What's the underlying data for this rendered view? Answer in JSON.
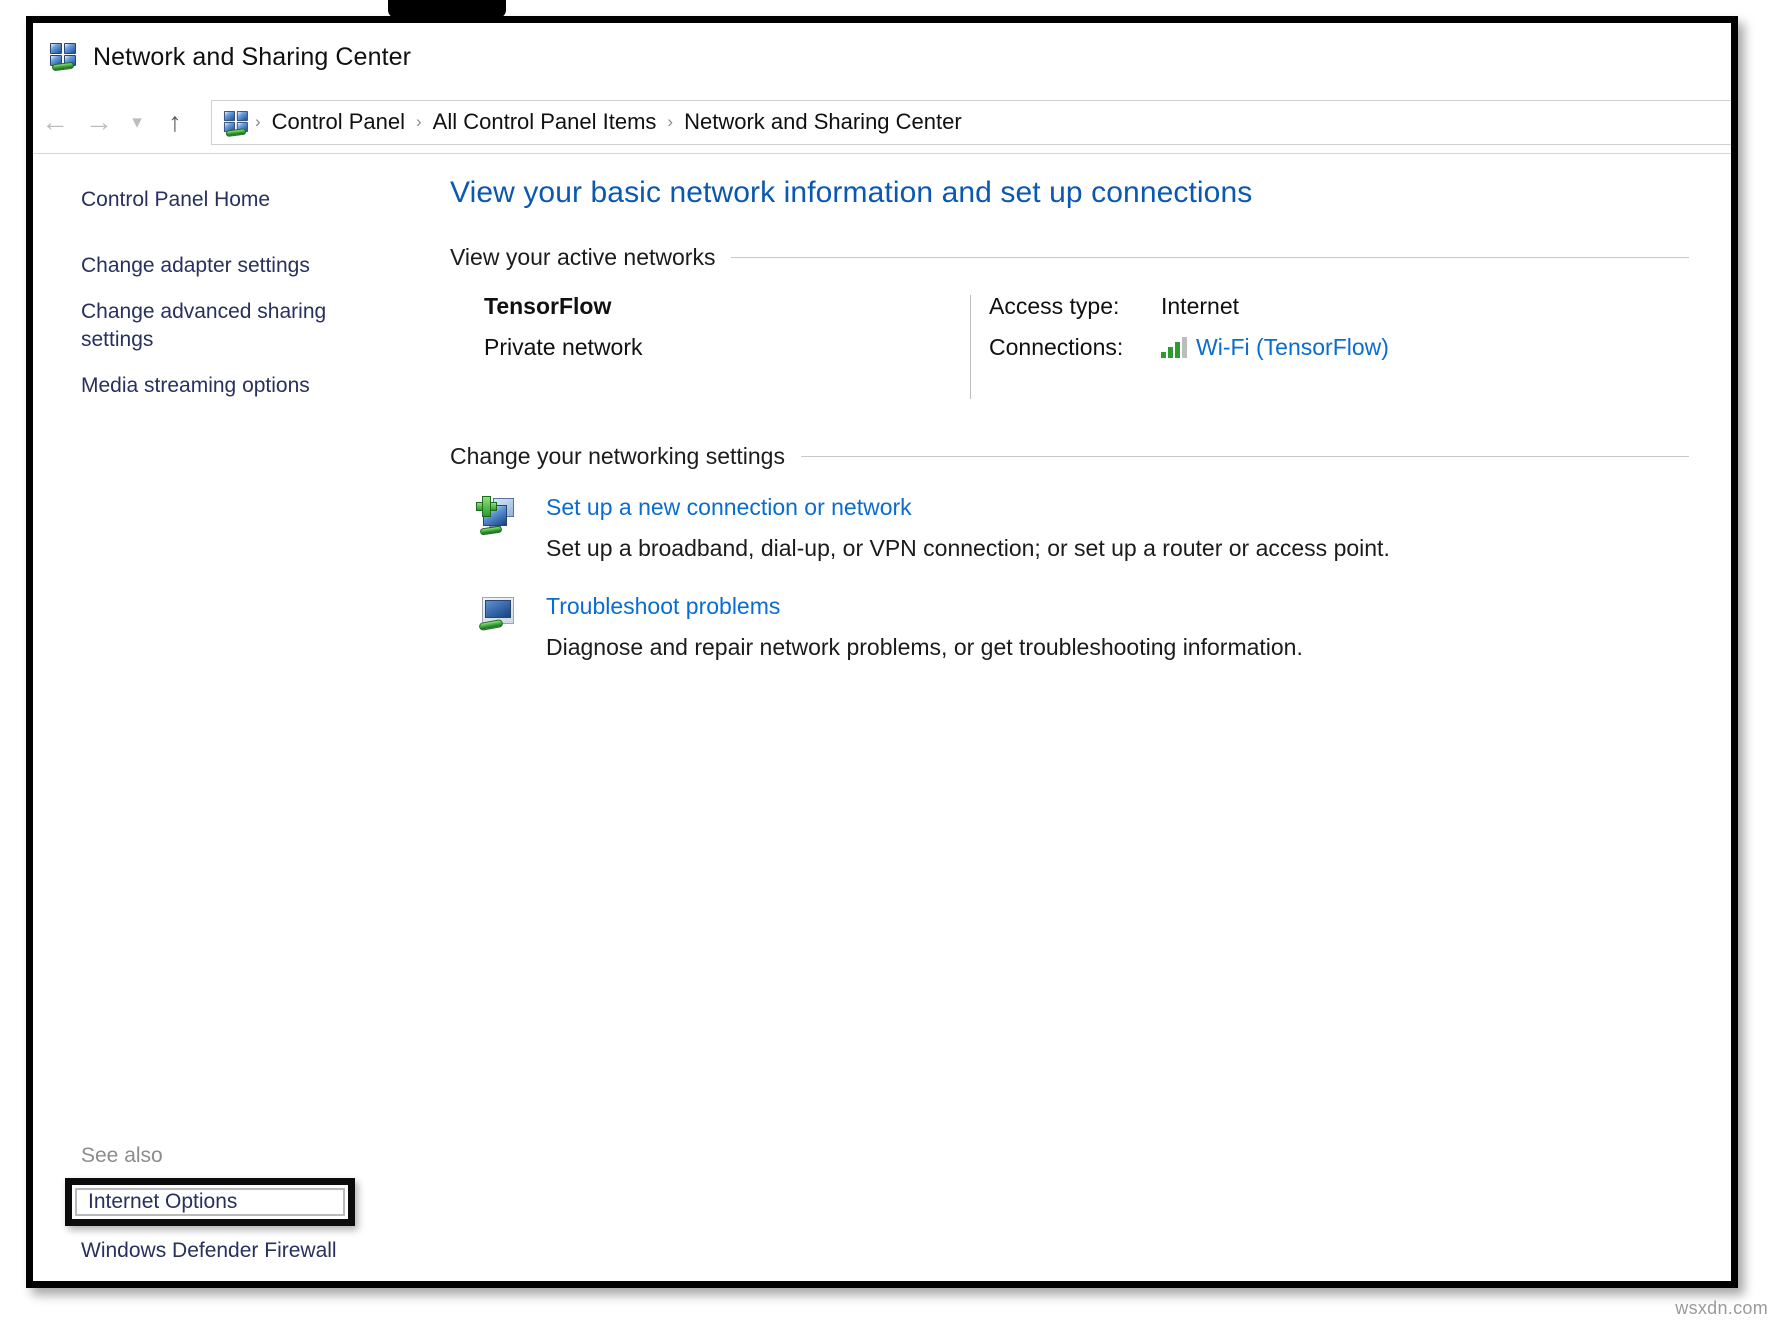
{
  "window": {
    "title": "Network and Sharing Center",
    "title_icon": "network-sharing-icon"
  },
  "navbar": {
    "back_icon": "arrow-left-icon",
    "forward_icon": "arrow-right-icon",
    "recent_icon": "chevron-down-icon",
    "up_icon": "arrow-up-icon",
    "address_icon": "network-sharing-icon",
    "separator": "›",
    "breadcrumbs": [
      {
        "label": "Control Panel"
      },
      {
        "label": "All Control Panel Items"
      },
      {
        "label": "Network and Sharing Center"
      }
    ]
  },
  "sidebar": {
    "links": [
      {
        "label": "Control Panel Home"
      },
      {
        "label": "Change adapter settings"
      },
      {
        "label": "Change advanced sharing settings"
      },
      {
        "label": "Media streaming options"
      }
    ],
    "see_also": {
      "label": "See also",
      "highlighted_item": "Internet Options",
      "items": [
        {
          "label": "Internet Options",
          "highlighted": true
        },
        {
          "label": "Windows Defender Firewall",
          "highlighted": false
        }
      ]
    }
  },
  "main": {
    "heading": "View your basic network information and set up connections",
    "active_networks": {
      "section_title": "View your active networks",
      "network_name": "TensorFlow",
      "network_type": "Private network",
      "details": [
        {
          "key": "Access type:",
          "value": "Internet",
          "is_link": false
        },
        {
          "key": "Connections:",
          "value": "Wi-Fi (TensorFlow)",
          "is_link": true,
          "icon": "wifi-signal-icon"
        }
      ]
    },
    "networking_settings": {
      "section_title": "Change your networking settings",
      "items": [
        {
          "icon": "new-connection-icon",
          "link": "Set up a new connection or network",
          "description": "Set up a broadband, dial-up, or VPN connection; or set up a router or access point."
        },
        {
          "icon": "troubleshoot-icon",
          "link": "Troubleshoot problems",
          "description": "Diagnose and repair network problems, or get troubleshooting information."
        }
      ]
    }
  },
  "watermark": "wsxdn.com",
  "colors": {
    "heading_blue": "#0a58b0",
    "link_blue": "#0a6ccf",
    "sidebar_link": "#27305e",
    "muted": "#8c8c8c",
    "signal_green": "#2f9a31",
    "signal_gray": "#bdbdbd",
    "highlight_border": "#0c0c0c"
  }
}
